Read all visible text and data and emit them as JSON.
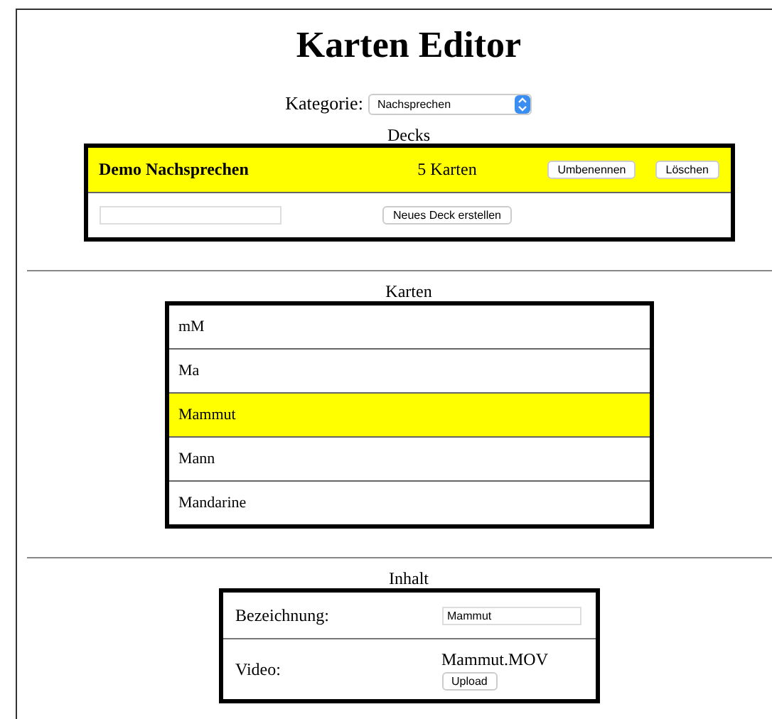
{
  "title": "Karten Editor",
  "category": {
    "label": "Kategorie:",
    "value": "Nachsprechen"
  },
  "decks": {
    "heading": "Decks",
    "rows": [
      {
        "name": "Demo Nachsprechen",
        "count": "5 Karten",
        "selected": true,
        "buttons": [
          "Umbenennen",
          "Löschen"
        ]
      }
    ],
    "new_deck_button": "Neues Deck erstellen"
  },
  "cards": {
    "heading": "Karten",
    "rows": [
      {
        "label": "mM",
        "selected": false
      },
      {
        "label": "Ma",
        "selected": false
      },
      {
        "label": "Mammut",
        "selected": true
      },
      {
        "label": "Mann",
        "selected": false
      },
      {
        "label": "Mandarine",
        "selected": false
      }
    ]
  },
  "content": {
    "heading": "Inhalt",
    "name_label": "Bezeichnung:",
    "name_value": "Mammut",
    "video_label": "Video:",
    "video_file": "Mammut.MOV",
    "upload_button": "Upload"
  }
}
